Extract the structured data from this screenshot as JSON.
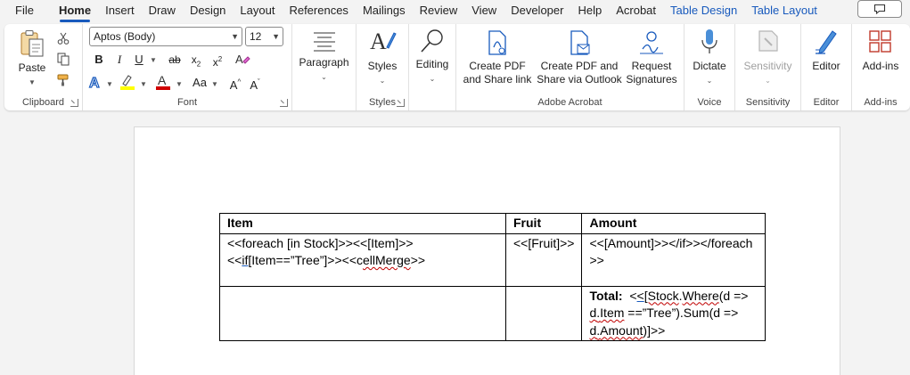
{
  "tabs": [
    {
      "label": "File",
      "active": false,
      "context": false
    },
    {
      "label": "Home",
      "active": true,
      "context": false
    },
    {
      "label": "Insert",
      "active": false,
      "context": false
    },
    {
      "label": "Draw",
      "active": false,
      "context": false
    },
    {
      "label": "Design",
      "active": false,
      "context": false
    },
    {
      "label": "Layout",
      "active": false,
      "context": false
    },
    {
      "label": "References",
      "active": false,
      "context": false
    },
    {
      "label": "Mailings",
      "active": false,
      "context": false
    },
    {
      "label": "Review",
      "active": false,
      "context": false
    },
    {
      "label": "View",
      "active": false,
      "context": false
    },
    {
      "label": "Developer",
      "active": false,
      "context": false
    },
    {
      "label": "Help",
      "active": false,
      "context": false
    },
    {
      "label": "Acrobat",
      "active": false,
      "context": false
    },
    {
      "label": "Table Design",
      "active": false,
      "context": true
    },
    {
      "label": "Table Layout",
      "active": false,
      "context": true
    }
  ],
  "ribbon": {
    "clipboard": {
      "label": "Clipboard",
      "paste": "Paste"
    },
    "font": {
      "label": "Font",
      "family": "Aptos (Body)",
      "size": "12"
    },
    "paragraph": {
      "label": "Paragraph"
    },
    "styles": {
      "label": "Styles",
      "button": "Styles"
    },
    "editing": {
      "button": "Editing"
    },
    "acrobat": {
      "label": "Adobe Acrobat",
      "create_pdf_line1": "Create PDF",
      "create_pdf_line2": "and Share link",
      "outlook_line1": "Create PDF and",
      "outlook_line2": "Share via Outlook",
      "request_line1": "Request",
      "request_line2": "Signatures"
    },
    "voice": {
      "label": "Voice",
      "button": "Dictate"
    },
    "sensitivity": {
      "label": "Sensitivity",
      "button": "Sensitivity"
    },
    "editor": {
      "label": "Editor",
      "button": "Editor"
    },
    "addins": {
      "label": "Add-ins",
      "button": "Add-ins"
    }
  },
  "colors": {
    "accent": "#185abd",
    "font_color": "#d00000",
    "highlight": "#ffff00"
  },
  "document": {
    "headers": [
      "Item",
      "Fruit",
      "Amount"
    ],
    "row1": {
      "item_a": "<<foreach [in Stock]>><<[Item]>><<",
      "item_if": "if",
      "item_b": "[Item==”Tree”]>><<c",
      "item_merge": "ellMerge",
      "item_c": ">>",
      "fruit": "<<[Fruit]>>",
      "amount": "<<[Amount]>></if>></foreach>>"
    },
    "row2": {
      "total_label": "Total:",
      "expr_a": "<",
      "expr_b": "<",
      "expr_stock": "[Stock",
      "expr_dot": ".",
      "expr_where": "Where",
      "expr_c": "(d => ",
      "expr_d": "d",
      "expr_e": ".",
      "expr_item": "Item",
      "expr_f": " ==”Tree”).Sum(d => ",
      "expr_g": "d",
      "expr_h": ".",
      "expr_amount": "Amount",
      "expr_i": ")]>>"
    }
  }
}
